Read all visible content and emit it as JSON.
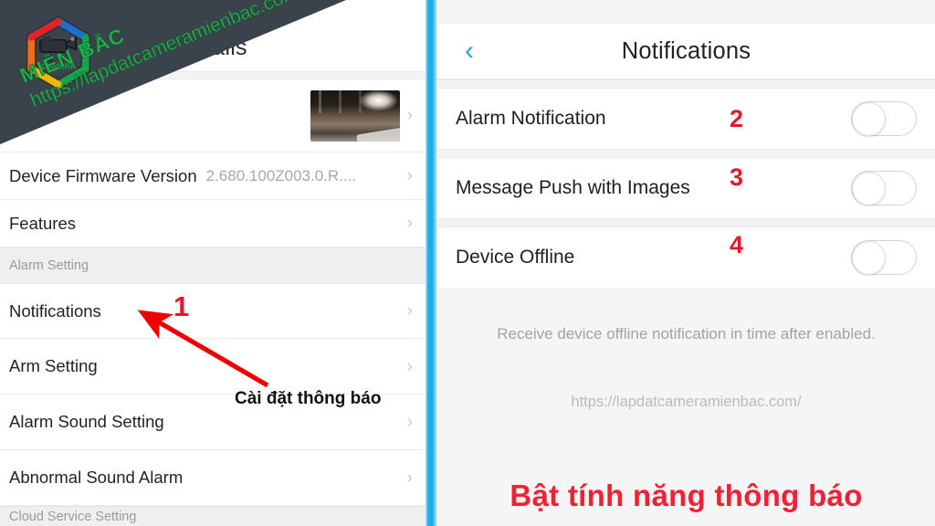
{
  "left_panel": {
    "header_title": "tails",
    "rows": [
      {
        "name": "device-thumbnail-row",
        "label": "",
        "value": "",
        "chevron": "›",
        "kind": "thumb"
      },
      {
        "name": "device-firmware-version-row",
        "label": "Device Firmware Version",
        "value": "2.680.100Z003.0.R....",
        "chevron": "›",
        "kind": "text"
      },
      {
        "name": "features-row",
        "label": "Features",
        "value": "",
        "chevron": "›",
        "kind": "text"
      }
    ],
    "group_alarm_setting": "Alarm Setting",
    "alarm_rows": [
      {
        "name": "notifications-row",
        "label": "Notifications",
        "chevron": "›"
      },
      {
        "name": "arm-setting-row",
        "label": "Arm Setting",
        "chevron": "›"
      },
      {
        "name": "alarm-sound-setting-row",
        "label": "Alarm Sound Setting",
        "chevron": "›"
      },
      {
        "name": "abnormal-sound-alarm-row",
        "label": "Abnormal Sound Alarm",
        "chevron": "›"
      }
    ],
    "group_cloud_service": "Cloud Service Setting"
  },
  "right_panel": {
    "back_icon": "‹",
    "title": "Notifications",
    "rows": [
      {
        "name": "alarm-notification-row",
        "label": "Alarm Notification",
        "marker": "2",
        "toggle_state": "off"
      },
      {
        "name": "message-push-with-images-row",
        "label": "Message Push with Images",
        "marker": "3",
        "toggle_state": "off"
      },
      {
        "name": "device-offline-row",
        "label": "Device Offline",
        "marker": "4",
        "toggle_state": "off"
      }
    ],
    "description": "Receive device offline notification in time after enabled.",
    "url": "https://lapdatcameramienbac.com/",
    "callout": "Bật tính năng thông báo"
  },
  "annotations": {
    "marker_1": "1",
    "caption_1": "Cài đặt thông báo"
  },
  "watermark": {
    "brand": "MIỀN BẮC",
    "url": "https://lapdatcameramienbac.com/",
    "logo_text": "CAMERA"
  },
  "colors": {
    "accent_blue": "#18a9e8",
    "marker_red": "#e3182a",
    "callout_red": "#ef2135",
    "watermark_green": "#22b24c",
    "overlay_dark": "#3a424b"
  }
}
